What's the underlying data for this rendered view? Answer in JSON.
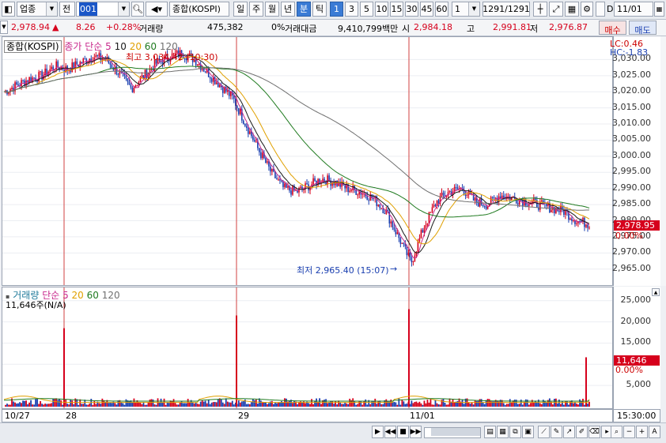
{
  "toolbar": {
    "market": "업종",
    "board": "전",
    "code": "001",
    "name": "종합(KOSPI)",
    "periods": [
      "일",
      "주",
      "월",
      "년",
      "분",
      "틱"
    ],
    "active_period": "분",
    "intervals": [
      "1",
      "3",
      "5",
      "10",
      "15",
      "30",
      "45",
      "60"
    ],
    "active_interval": "1",
    "count": "1",
    "pages": "1291/1291",
    "date_checkbox_label": "D",
    "date": "11/01"
  },
  "infobar": {
    "price": "2,978.94",
    "arrow": "▲",
    "change": "8.26",
    "change_pct": "+0.28%",
    "volume_label": "거래량",
    "volume": "475,382",
    "vol_pct": "0%",
    "amount_label": "거래대금",
    "amount": "9,410,799백만",
    "open_label": "시",
    "open": "2,984.18",
    "high_label": "고",
    "high": "2,991.81",
    "low_label": "저",
    "low": "2,976.87"
  },
  "buttons": {
    "buy": "매수",
    "sell": "매도"
  },
  "price_panel": {
    "title": "종합(KOSPI)",
    "legend": [
      {
        "text": "종가",
        "color": "#c8288c"
      },
      {
        "text": "단순",
        "color": "#c8288c"
      },
      {
        "text": "5",
        "color": "#c8288c"
      },
      {
        "text": "10",
        "color": "#1a1a1a"
      },
      {
        "text": "20",
        "color": "#e0a000"
      },
      {
        "text": "60",
        "color": "#1f7a1f"
      },
      {
        "text": "120",
        "color": "#707070"
      }
    ],
    "high_note": "최고 3,034.42 (10:30)",
    "low_note": "최저 2,965.40 (15:07)",
    "lc": "LC:0.46",
    "hc": "HC:-1.83",
    "current_tag": "2,978.95",
    "current_pct": "0.00%"
  },
  "volume_panel": {
    "legend": [
      {
        "text": "거래량",
        "color": "#1f7a9a"
      },
      {
        "text": "단순",
        "color": "#c8288c"
      },
      {
        "text": "5",
        "color": "#c8288c"
      },
      {
        "text": "20",
        "color": "#e0a000"
      },
      {
        "text": "60",
        "color": "#1f7a1f"
      },
      {
        "text": "120",
        "color": "#707070"
      }
    ],
    "sub": "11,646주(N/A)",
    "current_tag": "11,646",
    "current_pct": "0.00%"
  },
  "x_axis": {
    "labels": [
      "10/27",
      "28",
      "29",
      "11/01"
    ],
    "time": "15:30:00"
  },
  "colors": {
    "up": "#d6001c",
    "down": "#1a3fb0",
    "ma5": "#c8288c",
    "ma10": "#1a1a1a",
    "ma20": "#e0a000",
    "ma60": "#1f7a1f",
    "ma120": "#707070"
  },
  "chart_data": [
    {
      "type": "line",
      "description_series": "KOSPI 1-minute candles with moving averages",
      "x": [
        "10/27",
        "28",
        "29",
        "11/01"
      ],
      "y_ticks": [
        "3,030.00",
        "3,025.00",
        "3,020.00",
        "3,015.00",
        "3,010.00",
        "3,005.00",
        "3,000.00",
        "2,995.00",
        "2,990.00",
        "2,985.00",
        "2,980.00",
        "2,975.00",
        "2,970.00",
        "2,965.00"
      ],
      "ylim": [
        2962,
        3035
      ],
      "close_path": [
        3020,
        3022,
        3024,
        3025,
        3028,
        3027,
        3029,
        3031,
        3030,
        3026,
        3021,
        3025,
        3029,
        3031,
        3032,
        3030,
        3026,
        3022,
        3018,
        3010,
        3002,
        2995,
        2990,
        2989,
        2991,
        2993,
        2992,
        2990,
        2989,
        2987,
        2983,
        2975,
        2967,
        2978,
        2986,
        2989,
        2990,
        2986,
        2985,
        2988,
        2987,
        2986,
        2985,
        2984,
        2983,
        2980,
        2979
      ],
      "highlights": {
        "high": 3034.42,
        "high_time": "10:30",
        "low": 2965.4,
        "low_time": "15:07",
        "current": 2978.95
      }
    },
    {
      "type": "bar",
      "title": "거래량",
      "y_ticks": [
        "25,000",
        "20,000",
        "15,000",
        "10,000",
        "5,000"
      ],
      "ylim": [
        0,
        27000
      ],
      "spikes": [
        {
          "at": "28",
          "value": 18500
        },
        {
          "at": "29",
          "value": 21500
        },
        {
          "at": "11/01",
          "value": 23000
        },
        {
          "at": "end",
          "value": 11646
        }
      ],
      "current": 11646
    }
  ]
}
